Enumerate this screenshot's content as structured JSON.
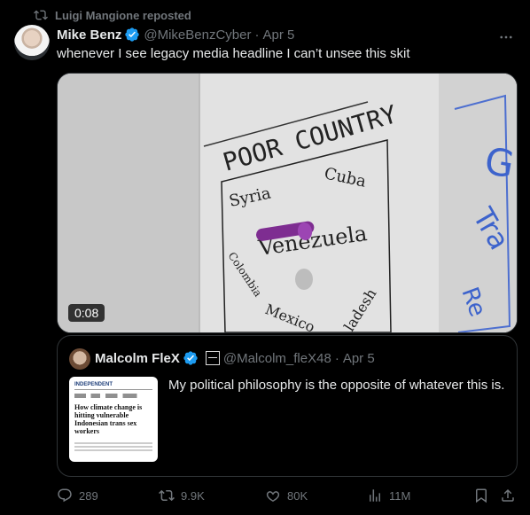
{
  "repost": {
    "label": "Luigi Mangione reposted"
  },
  "tweet": {
    "name": "Mike Benz",
    "handle": "@MikeBenzCyber",
    "separator": "·",
    "date": "Apr 5",
    "text": "whenever I see legacy media headline I can’t unsee this skit",
    "video": {
      "duration": "0:08",
      "board": {
        "title": "POOR COUNTRY",
        "words": [
          "Syria",
          "Cuba",
          "Venezuela",
          "Colombia",
          "Mexico",
          "ladesh",
          "Tra",
          "Re",
          "G"
        ]
      }
    }
  },
  "quote": {
    "name": "Malcolm FleX",
    "handle": "@Malcolm_fleX48",
    "separator": "·",
    "date": "Apr 5",
    "text": "My political philosophy is the opposite of whatever this is.",
    "thumbnail": {
      "masthead": "INDEPENDENT",
      "headline": "How climate change is hitting vulnerable Indonesian trans sex workers"
    }
  },
  "actions": {
    "replies": "289",
    "reposts": "9.9K",
    "likes": "80K",
    "views": "11M"
  },
  "colors": {
    "accent": "#1d9bf0",
    "muted": "#71767b",
    "border": "#2f3336"
  }
}
